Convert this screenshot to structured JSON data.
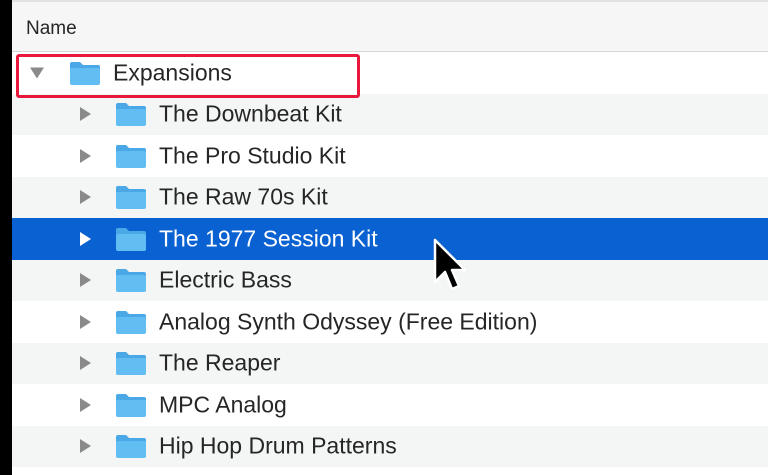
{
  "header": {
    "column_name": "Name"
  },
  "tree": {
    "root": {
      "label": "Expansions",
      "expanded": true,
      "icon": "folder-icon"
    },
    "children": [
      {
        "label": "The Downbeat Kit",
        "icon": "folder-icon",
        "selected": false
      },
      {
        "label": "The Pro Studio Kit",
        "icon": "folder-icon",
        "selected": false
      },
      {
        "label": "The Raw 70s Kit",
        "icon": "folder-icon",
        "selected": false
      },
      {
        "label": "The 1977 Session Kit",
        "icon": "folder-icon",
        "selected": true
      },
      {
        "label": "Electric Bass",
        "icon": "folder-icon",
        "selected": false
      },
      {
        "label": "Analog Synth Odyssey (Free Edition)",
        "icon": "folder-icon",
        "selected": false
      },
      {
        "label": "The Reaper",
        "icon": "folder-icon",
        "selected": false
      },
      {
        "label": "MPC Analog",
        "icon": "folder-icon",
        "selected": false
      },
      {
        "label": "Hip Hop Drum Patterns",
        "icon": "folder-icon",
        "selected": false
      }
    ]
  },
  "colors": {
    "selection": "#0a61d1",
    "highlight_box": "#e8193c",
    "folder": "#5fb9f0"
  },
  "cursor_icon": "arrow-cursor-icon"
}
